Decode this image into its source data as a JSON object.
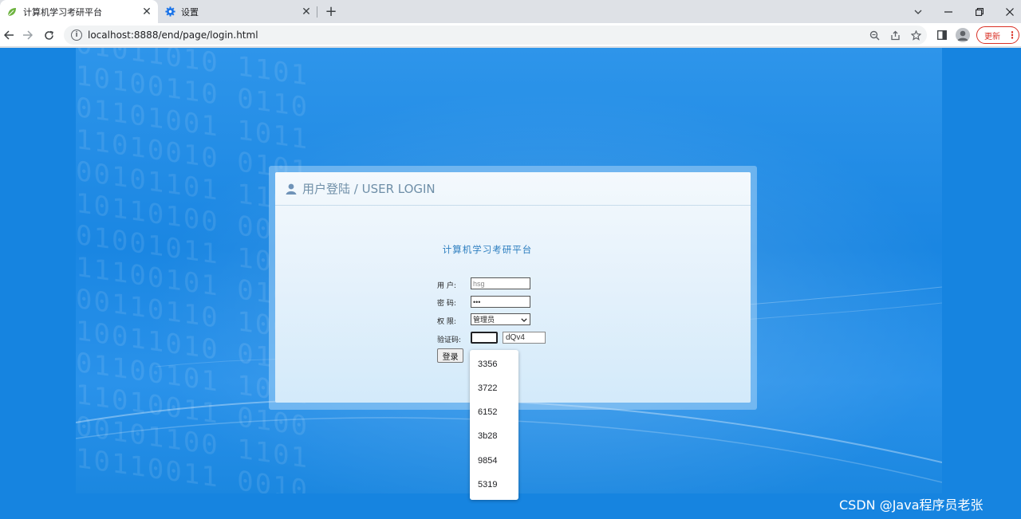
{
  "browser": {
    "tabs": [
      {
        "title": "计算机学习考研平台",
        "icon": "leaf-icon",
        "active": true
      },
      {
        "title": "设置",
        "icon": "gear-icon",
        "active": false
      }
    ],
    "url": "localhost:8888/end/page/login.html",
    "update_label": "更新"
  },
  "login": {
    "header_title": "用户登陆 / USER LOGIN",
    "platform_title": "计算机学习考研平台",
    "username_label": "用  户:",
    "username_value": "hsg",
    "password_label": "密  码:",
    "password_value": "•••",
    "role_label": "权  限:",
    "role_value": "管理员",
    "captcha_label": "验证码:",
    "captcha_value": "",
    "captcha_code": "dQv4",
    "submit_label": "登录"
  },
  "autocomplete": [
    "3356",
    "3722",
    "6152",
    "3b28",
    "9854",
    "5319"
  ],
  "watermark": "CSDN @Java程序员老张",
  "colors": {
    "page_bg": "#1684e0",
    "title_blue": "#2e7fc0",
    "update_red": "#d93025"
  }
}
